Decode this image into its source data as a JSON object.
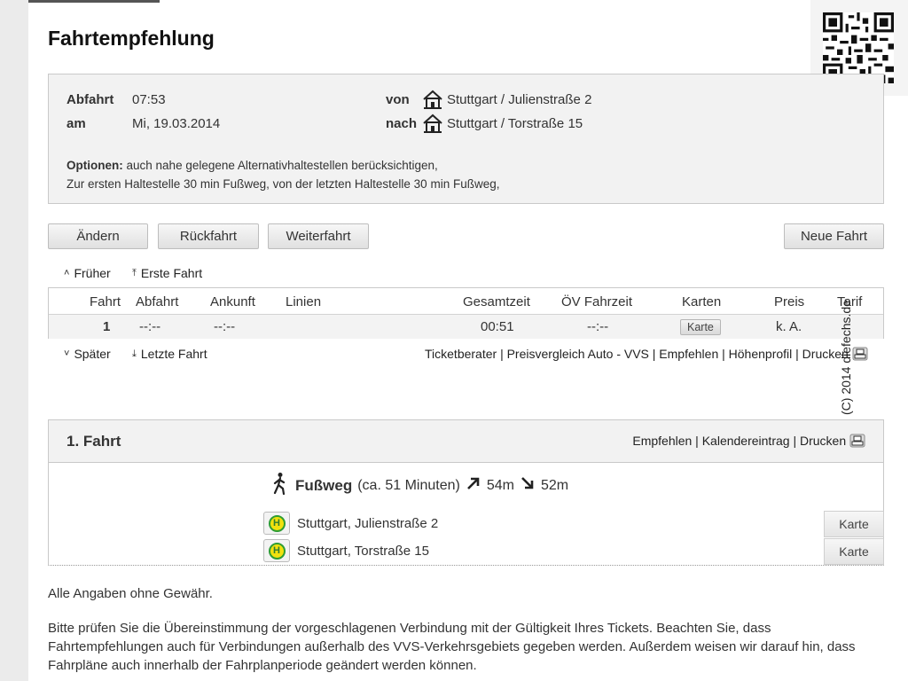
{
  "page_title": "Fahrtempfehlung",
  "summary": {
    "abfahrt_label": "Abfahrt",
    "abfahrt_value": "07:53",
    "am_label": "am",
    "am_value": "Mi, 19.03.2014",
    "von_label": "von",
    "von_value": "Stuttgart / Julienstraße 2",
    "nach_label": "nach",
    "nach_value": "Stuttgart / Torstraße 15",
    "optionen_label": "Optionen:",
    "optionen_line1": "auch nahe gelegene Alternativhaltestellen berücksichtigen,",
    "optionen_line2": "Zur ersten Haltestelle 30 min Fußweg, von der letzten Haltestelle 30 min Fußweg,"
  },
  "buttons": {
    "aendern": "Ändern",
    "rueckfahrt": "Rückfahrt",
    "weiterfahrt": "Weiterfahrt",
    "neue_fahrt": "Neue Fahrt"
  },
  "nav": {
    "frueher": "Früher",
    "erste_fahrt": "Erste Fahrt",
    "spaeter": "Später",
    "letzte_fahrt": "Letzte Fahrt"
  },
  "table": {
    "headers": {
      "fahrt": "Fahrt",
      "abfahrt": "Abfahrt",
      "ankunft": "Ankunft",
      "linien": "Linien",
      "gesamtzeit": "Gesamtzeit",
      "oev_fahrzeit": "ÖV Fahrzeit",
      "karten": "Karten",
      "preis": "Preis",
      "tarif": "Tarif"
    },
    "row": {
      "fahrt": "1",
      "abfahrt": "--:--",
      "ankunft": "--:--",
      "gesamtzeit": "00:51",
      "oev_fahrzeit": "--:--",
      "karten": "Karte",
      "preis": "k. A."
    }
  },
  "links_line": "Ticketberater | Preisvergleich Auto - VVS | Empfehlen | Höhenprofil | Drucken",
  "watermark": "(C) 2014 diefechs.de",
  "detail": {
    "title": "1. Fahrt",
    "links": "Empfehlen | Kalendereintrag | Drucken",
    "walk_label": "Fußweg",
    "walk_duration": "(ca. 51 Minuten)",
    "walk_up": "54m",
    "walk_down": "52m",
    "stop1": "Stuttgart, Julienstraße 2",
    "stop2": "Stuttgart, Torstraße 15",
    "stop_badge": "H",
    "karte1": "Karte",
    "karte2": "Karte"
  },
  "footer": {
    "disclaimer": "Alle Angaben ohne Gewähr.",
    "notice": "Bitte prüfen Sie die Übereinstimmung der vorgeschlagenen Verbindung mit der Gültigkeit Ihres Tickets. Beachten Sie, dass Fahrtempfehlungen auch für Verbindungen außerhalb des VVS-Verkehrsgebiets gegeben werden. Außerdem weisen wir darauf hin, dass Fahrpläne auch innerhalb der Fahrplanperiode geändert werden können."
  },
  "icons": {
    "house": "house-icon",
    "walk": "pedestrian-icon",
    "up": "arrow-up-right-icon",
    "down": "arrow-down-right-icon",
    "printer": "printer-icon",
    "stop": "bus-stop-icon",
    "qr": "qr-code-icon"
  },
  "colors": {
    "stop_badge_fill": "#f1e10e",
    "stop_badge_ring": "#2f9d32"
  }
}
